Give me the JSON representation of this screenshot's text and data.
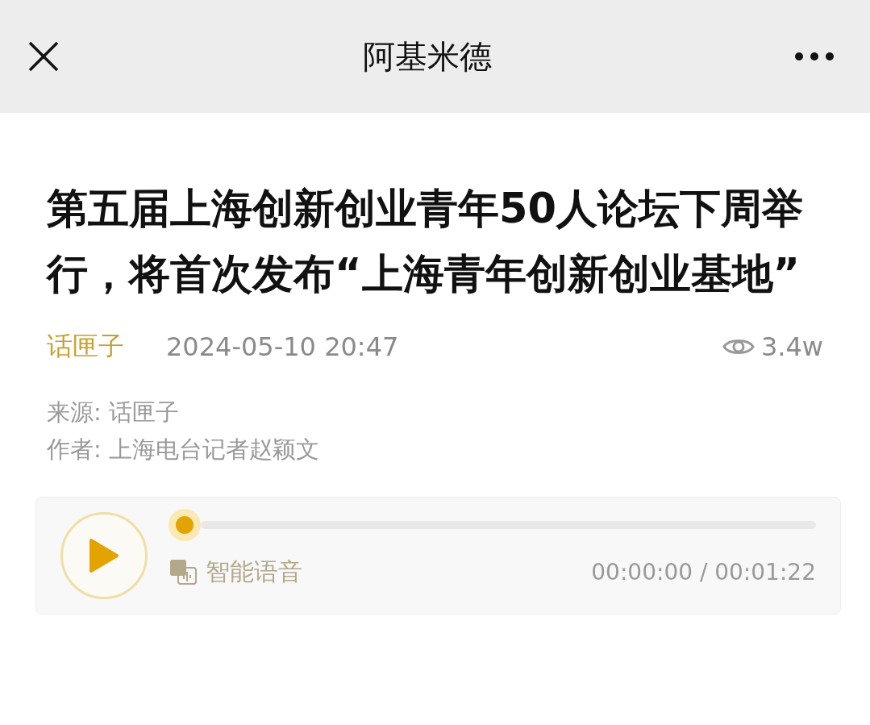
{
  "nav_bar": {
    "title": "阿基米德"
  },
  "article": {
    "title": "第五届上海创新创业青年50人论坛下周举行，将首次发布“上海青年创新创业基地”",
    "account": "话匣子",
    "date": "2024-05-10 20:47",
    "views": "3.4w",
    "source": "来源: 话匣子",
    "author": "作者: 上海电台记者赵颖文"
  },
  "audio_player": {
    "level": 0,
    "label": "智能语音",
    "time": "00:00:00 / 00:01:22"
  }
}
